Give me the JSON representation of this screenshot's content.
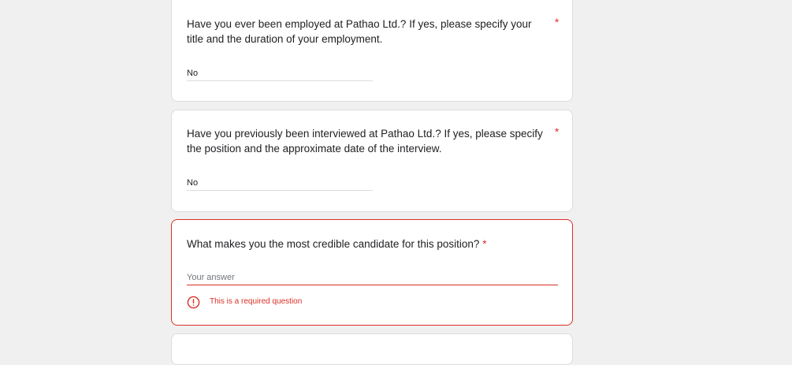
{
  "questions": [
    {
      "title": "Have you ever been employed at Pathao Ltd.? If yes, please specify your title and the duration of your employment.",
      "required_mark": "*",
      "answer": "No"
    },
    {
      "title": "Have you previously been interviewed at Pathao Ltd.? If yes, please specify the position and the approximate date of the interview.",
      "required_mark": "*",
      "answer": "No"
    },
    {
      "title": "What makes you the most credible candidate for this position?",
      "required_mark": "*",
      "placeholder": "Your answer",
      "error": "This is a required question"
    }
  ],
  "colors": {
    "error": "#d93025",
    "border": "#dadce0",
    "background": "#f0f0f0"
  }
}
